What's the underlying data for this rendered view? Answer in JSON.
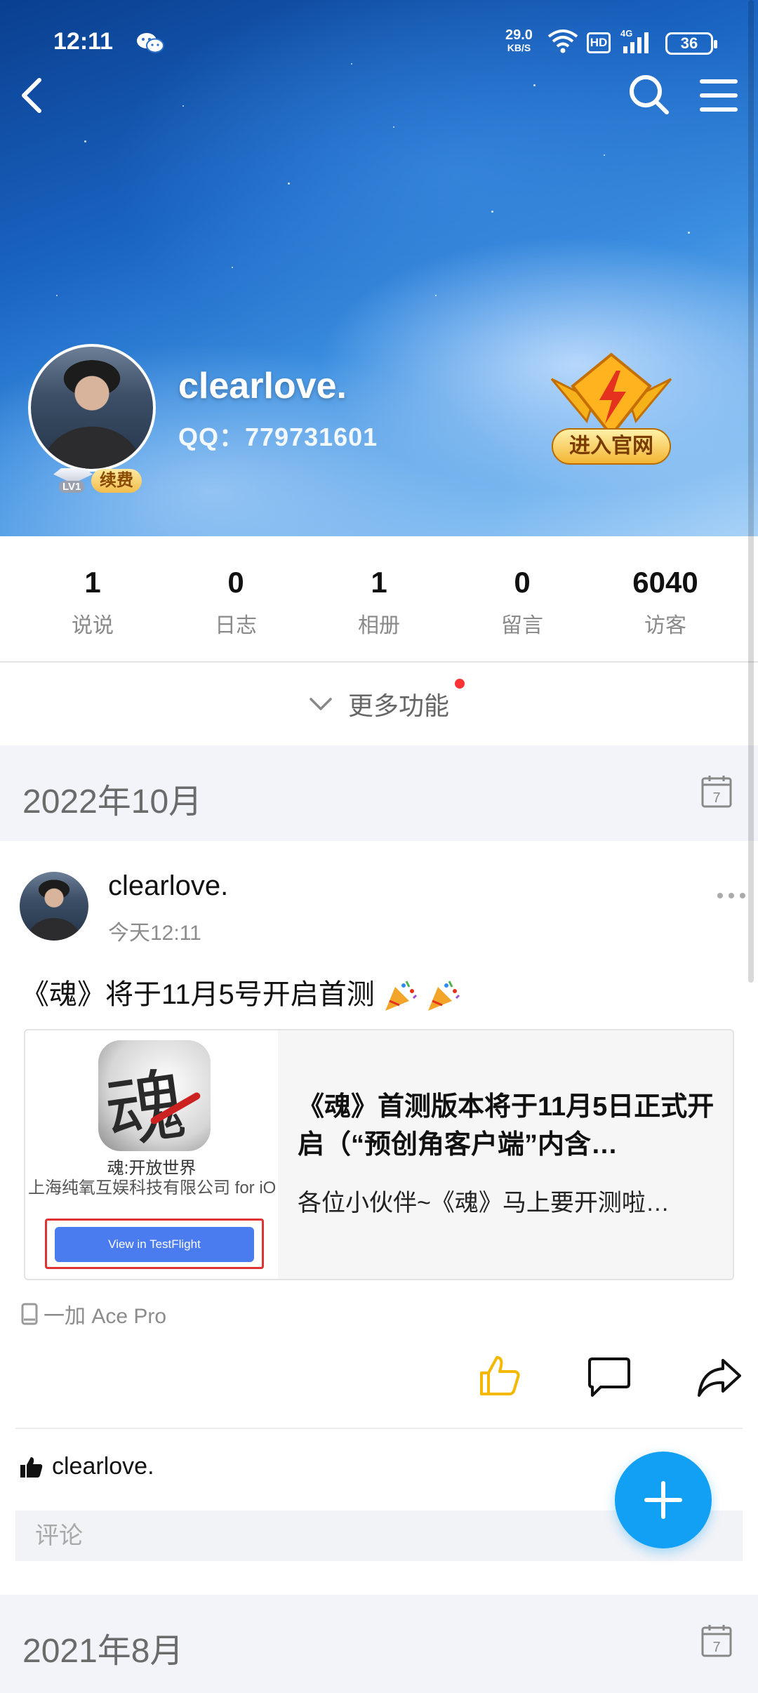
{
  "status_bar": {
    "time": "12:11",
    "speed_value": "29.0",
    "speed_unit": "KB/S",
    "hd": "HD",
    "network": "4G",
    "battery": "36"
  },
  "profile": {
    "name": "clearlove.",
    "qq": "QQ：779731601",
    "level": "LV1",
    "renew_label": "续费",
    "official_label": "进入官网"
  },
  "stats": [
    {
      "value": "1",
      "label": "说说"
    },
    {
      "value": "0",
      "label": "日志"
    },
    {
      "value": "1",
      "label": "相册"
    },
    {
      "value": "0",
      "label": "留言"
    },
    {
      "value": "6040",
      "label": "访客"
    }
  ],
  "more_functions": "更多功能",
  "months": {
    "first": "2022年10月",
    "second": "2021年8月",
    "calendar_day": "7"
  },
  "post": {
    "author": "clearlove.",
    "time": "今天12:11",
    "text": "《魂》将于11月5号开启首测",
    "card": {
      "app_name": "魂:开放世界",
      "company": "上海纯氧互娱科技有限公司 for iOS",
      "button": "View in TestFlight",
      "icon_glyph": "魂",
      "title": "《魂》首测版本将于11月5日正式开启（“预创角客户端”内含…",
      "desc": "各位小伙伴~《魂》马上要开测啦…"
    },
    "device": "一加 Ace Pro",
    "liked_by": "clearlove.",
    "comment_placeholder": "评论"
  },
  "colors": {
    "accent": "#12a0f5",
    "like_active": "#f5b800",
    "badge_red": "#ff3333"
  },
  "icons": {
    "back": "chevron-left-icon",
    "search": "search-icon",
    "menu": "hamburger-menu-icon",
    "calendar": "calendar-icon",
    "like": "thumbs-up-icon",
    "comment": "comment-icon",
    "share": "share-icon",
    "add": "plus-icon"
  }
}
